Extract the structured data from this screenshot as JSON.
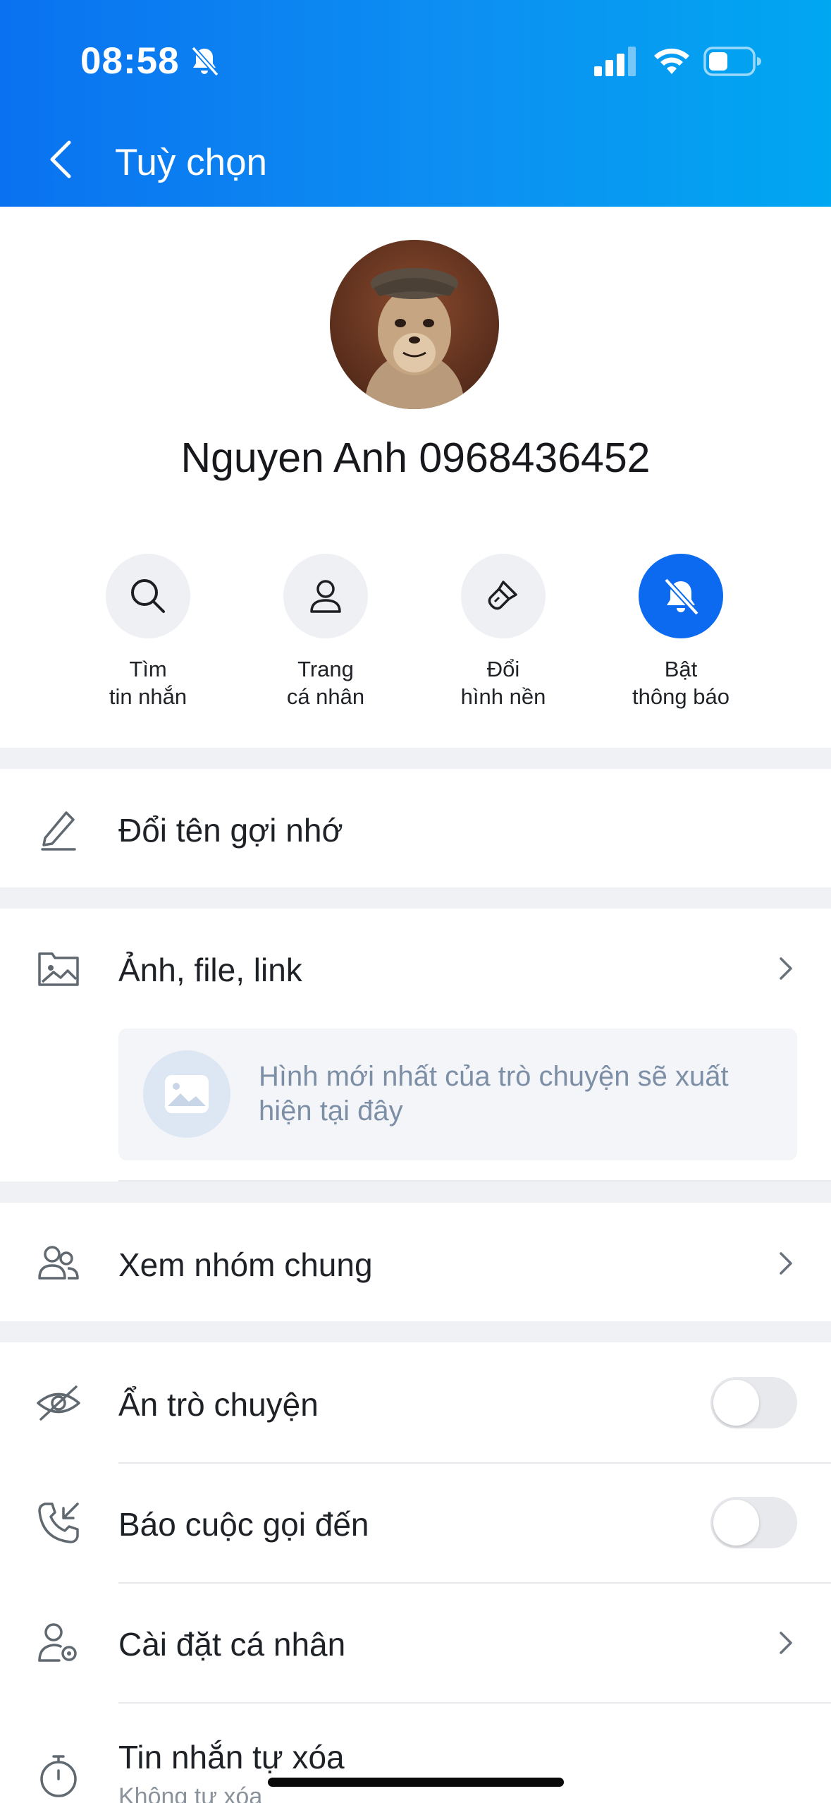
{
  "status_bar": {
    "time": "08:58",
    "battery_level": 0.4
  },
  "header": {
    "title": "Tuỳ chọn"
  },
  "profile": {
    "name": "Nguyen Anh 0968436452"
  },
  "actions": [
    {
      "line1": "Tìm",
      "line2": "tin nhắn",
      "icon": "search-icon"
    },
    {
      "line1": "Trang",
      "line2": "cá nhân",
      "icon": "person-icon"
    },
    {
      "line1": "Đổi",
      "line2": "hình nền",
      "icon": "paint-brush-icon"
    },
    {
      "line1": "Bật",
      "line2": "thông báo",
      "icon": "bell-off-icon"
    }
  ],
  "menu": {
    "rename": "Đổi tên gợi nhớ",
    "media": "Ảnh, file, link",
    "media_placeholder": "Hình mới nhất của trò chuyện sẽ xuất hiện tại đây",
    "common_groups": "Xem nhóm chung",
    "hide_chat": "Ẩn trò chuyện",
    "incoming_call": "Báo cuộc gọi đến",
    "personal_settings": "Cài đặt cá nhân",
    "auto_delete": "Tin nhắn tự xóa",
    "auto_delete_value": "Không tự xóa"
  },
  "toggles": {
    "hide_chat": false,
    "incoming_call": false
  },
  "colors": {
    "accent": "#0c6af1",
    "header_gradient_start": "#0a72f0",
    "header_gradient_end": "#00a7f1"
  }
}
